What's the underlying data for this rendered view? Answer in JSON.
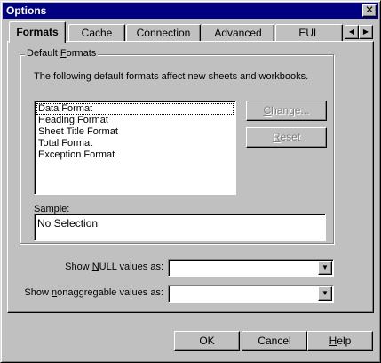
{
  "window": {
    "title": "Options",
    "close_label": "✕"
  },
  "tabs": [
    {
      "label": "Formats",
      "active": true
    },
    {
      "label": "Cache",
      "active": false
    },
    {
      "label": "Connection",
      "active": false
    },
    {
      "label": "Advanced",
      "active": false
    },
    {
      "label": "EUL",
      "active": false
    }
  ],
  "tab_scroll": {
    "left": "◀",
    "right": "▶"
  },
  "default_formats": {
    "group_label_prefix": "Default ",
    "group_label_hotkey": "F",
    "group_label_suffix": "ormats",
    "description": "The following default formats affect new sheets and workbooks.",
    "items": [
      "Data Format",
      "Heading Format",
      "Sheet Title Format",
      "Total Format",
      "Exception Format"
    ],
    "change_button": {
      "prefix": "",
      "hotkey": "C",
      "suffix": "hange..."
    },
    "reset_button": {
      "prefix": "",
      "hotkey": "R",
      "suffix": "eset"
    },
    "sample_label": "Sample:",
    "sample_value": "No Selection"
  },
  "null_values": {
    "label_prefix": "Show ",
    "label_hotkey": "N",
    "label_suffix": "ULL values as:",
    "value": ""
  },
  "nonaggregable_values": {
    "label_prefix": "Show ",
    "label_hotkey": "n",
    "label_suffix": "onaggregable values as:",
    "value": ""
  },
  "dropdown_arrow": "▼",
  "buttons": {
    "ok": "OK",
    "cancel": "Cancel",
    "help_hotkey": "H",
    "help_suffix": "elp"
  }
}
